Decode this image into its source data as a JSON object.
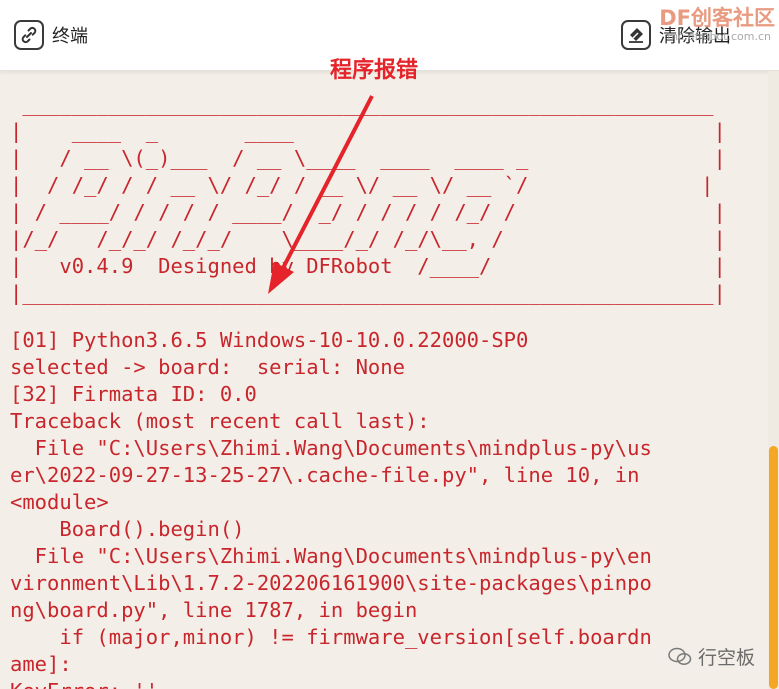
{
  "toolbar": {
    "terminal_label": "终端",
    "clear_label": "清除输出",
    "terminal_icon": "link-icon",
    "clear_icon": "eraser-icon"
  },
  "watermarks": {
    "top_brand": "DF创客社区",
    "top_url": "mc.dfrobot.com.cn",
    "bottom_brand": "行空板"
  },
  "annotation": {
    "label": "程序报错",
    "color": "#e4242a"
  },
  "banner": {
    "art": " ________________________________________________________\n|    ____  _       ____                                  |\n|   / __ \\(_)___  / __ \\____  ____  ____ _               |\n|  / /_/ / / __ \\/ /_/ / __ \\/ __ \\/ __ `/              |\n| / ____/ / / / / ____/ /_/ / / / / /_/ /                |\n|/_/   /_/_/ /_/_/    \\____/_/ /_/\\__, /                 |\n|   v0.4.9  Designed by DFRobot  /____/                  |\n|________________________________________________________|"
  },
  "log_lines": [
    "[01] Python3.6.5 Windows-10-10.0.22000-SP0",
    "selected -> board:  serial: None",
    "[32] Firmata ID: 0.0",
    "Traceback (most recent call last):",
    "  File \"C:\\Users\\Zhimi.Wang\\Documents\\mindplus-py\\us",
    "er\\2022-09-27-13-25-27\\.cache-file.py\", line 10, in",
    "<module>",
    "    Board().begin()",
    "  File \"C:\\Users\\Zhimi.Wang\\Documents\\mindplus-py\\en",
    "vironment\\Lib\\1.7.2-202206161900\\site-packages\\pinpo",
    "ng\\board.py\", line 1787, in begin",
    "    if (major,minor) != firmware_version[self.boardn",
    "ame]:",
    "KeyError: ''"
  ],
  "colors": {
    "terminal_text": "#c8262c",
    "background": "#f3efe8",
    "scroll_thumb": "#f5a623"
  }
}
